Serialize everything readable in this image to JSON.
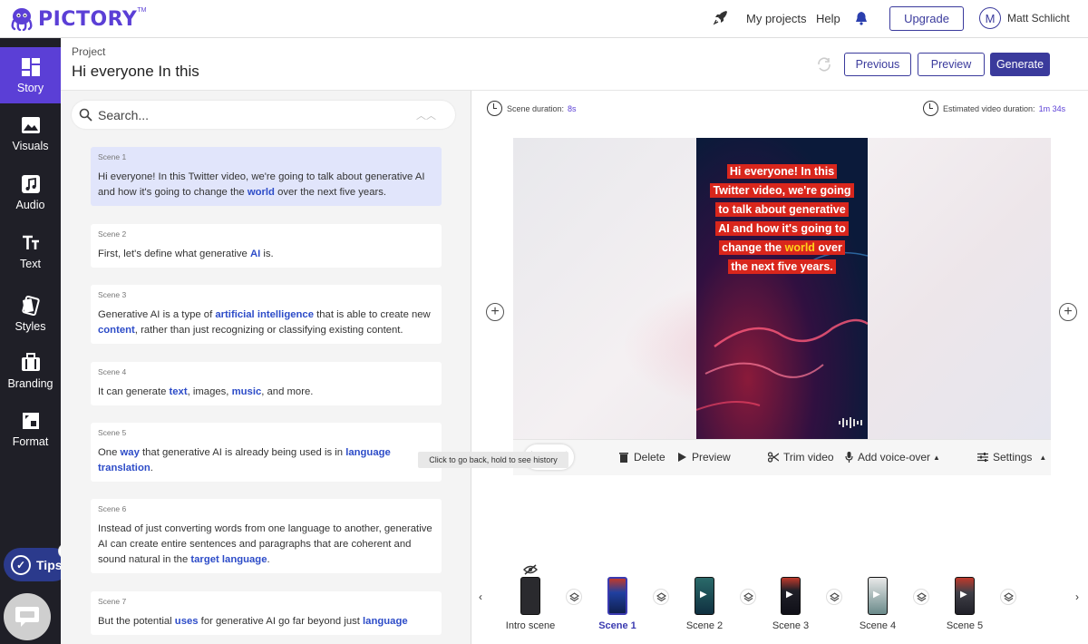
{
  "brand": {
    "name": "PICTORY",
    "tm": "TM",
    "primary_color": "#5b3fd6"
  },
  "topnav": {
    "rocket_icon": "rocket-icon",
    "my_projects": "My projects",
    "help": "Help",
    "bell_icon": "bell-icon",
    "upgrade": "Upgrade",
    "avatar_letter": "M",
    "username": "Matt Schlicht"
  },
  "sidebar": {
    "items": [
      {
        "label": "Story",
        "icon": "story-icon",
        "active": true
      },
      {
        "label": "Visuals",
        "icon": "visuals-icon"
      },
      {
        "label": "Audio",
        "icon": "audio-icon"
      },
      {
        "label": "Text",
        "icon": "text-icon"
      },
      {
        "label": "Styles",
        "icon": "styles-icon"
      },
      {
        "label": "Branding",
        "icon": "branding-icon"
      },
      {
        "label": "Format",
        "icon": "format-icon"
      }
    ],
    "tips_label": "Tips",
    "tips_count": "2"
  },
  "project": {
    "label": "Project",
    "title": "Hi everyone In this",
    "previous": "Previous",
    "preview": "Preview",
    "generate": "Generate"
  },
  "search": {
    "placeholder": "Search..."
  },
  "scenes": [
    {
      "num": "Scene 1",
      "segments": [
        {
          "t": "Hi everyone! In this Twitter video, we're going to talk about generative AI and how it's going to change the "
        },
        {
          "t": "world",
          "kw": true
        },
        {
          "t": " over the next five years."
        }
      ]
    },
    {
      "num": "Scene 2",
      "segments": [
        {
          "t": "First, let's define what generative "
        },
        {
          "t": "AI",
          "kw": true
        },
        {
          "t": " is."
        }
      ]
    },
    {
      "num": "Scene 3",
      "segments": [
        {
          "t": "Generative AI is a type of "
        },
        {
          "t": "artificial intelligence",
          "kw": true
        },
        {
          "t": " that is able to create new "
        },
        {
          "t": "content",
          "kw": true
        },
        {
          "t": ", rather than just recognizing or classifying existing content."
        }
      ]
    },
    {
      "num": "Scene 4",
      "segments": [
        {
          "t": "It can generate "
        },
        {
          "t": "text",
          "kw": true
        },
        {
          "t": ", images, "
        },
        {
          "t": "music",
          "kw": true
        },
        {
          "t": ", and more."
        }
      ]
    },
    {
      "num": "Scene 5",
      "segments": [
        {
          "t": "One "
        },
        {
          "t": "way",
          "kw": true
        },
        {
          "t": " that generative AI is already being used is in "
        },
        {
          "t": "language translation",
          "kw": true
        },
        {
          "t": "."
        }
      ]
    },
    {
      "num": "Scene 6",
      "segments": [
        {
          "t": "Instead of just converting words from one language to another, generative AI can create entire sentences and paragraphs that are coherent and sound natural in the "
        },
        {
          "t": "target language",
          "kw": true
        },
        {
          "t": "."
        }
      ]
    },
    {
      "num": "Scene 7",
      "segments": [
        {
          "t": "But the potential "
        },
        {
          "t": "uses",
          "kw": true
        },
        {
          "t": " for generative AI go far beyond just "
        },
        {
          "t": "language",
          "kw": true
        }
      ]
    }
  ],
  "editor": {
    "scene_duration_label": "Scene duration:",
    "scene_duration": "8s",
    "est_duration_label": "Estimated video duration:",
    "est_duration": "1m 34s",
    "caption_lines": [
      [
        {
          "t": "Hi everyone! In this"
        }
      ],
      [
        {
          "t": "Twitter video, we're going"
        }
      ],
      [
        {
          "t": "to talk about generative"
        }
      ],
      [
        {
          "t": "AI and how it's going to"
        }
      ],
      [
        {
          "t": "change the "
        },
        {
          "t": "world",
          "hl": true
        },
        {
          "t": " over"
        }
      ],
      [
        {
          "t": "the next five years."
        }
      ]
    ],
    "toolbar": {
      "delete": "Delete",
      "preview": "Preview",
      "trim": "Trim video",
      "voiceover": "Add voice-over",
      "settings": "Settings"
    },
    "history_tip": "Click to go back, hold to see history"
  },
  "timeline": {
    "items": [
      {
        "label": "Intro scene",
        "hidden": true
      },
      {
        "label": "Scene 1",
        "active": true
      },
      {
        "label": "Scene 2"
      },
      {
        "label": "Scene 3"
      },
      {
        "label": "Scene 4"
      },
      {
        "label": "Scene 5"
      }
    ]
  }
}
